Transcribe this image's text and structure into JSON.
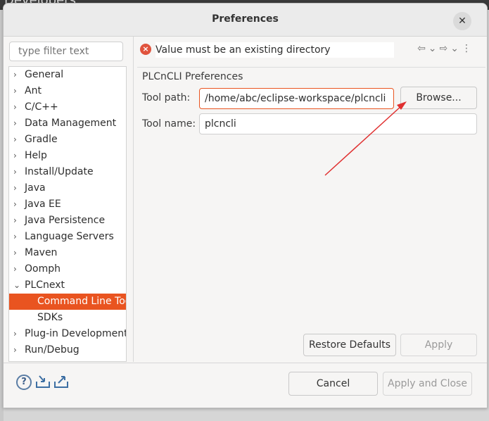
{
  "background": {
    "behind_text": "Developers"
  },
  "dialog": {
    "title": "Preferences",
    "close_glyph": "✕"
  },
  "filter": {
    "placeholder": "type filter text"
  },
  "tree": {
    "items": [
      {
        "label": "General",
        "expanded": false,
        "child": false
      },
      {
        "label": "Ant",
        "expanded": false,
        "child": false
      },
      {
        "label": "C/C++",
        "expanded": false,
        "child": false
      },
      {
        "label": "Data Management",
        "expanded": false,
        "child": false
      },
      {
        "label": "Gradle",
        "expanded": false,
        "child": false
      },
      {
        "label": "Help",
        "expanded": false,
        "child": false
      },
      {
        "label": "Install/Update",
        "expanded": false,
        "child": false
      },
      {
        "label": "Java",
        "expanded": false,
        "child": false
      },
      {
        "label": "Java EE",
        "expanded": false,
        "child": false
      },
      {
        "label": "Java Persistence",
        "expanded": false,
        "child": false
      },
      {
        "label": "Language Servers",
        "expanded": false,
        "child": false
      },
      {
        "label": "Maven",
        "expanded": false,
        "child": false
      },
      {
        "label": "Oomph",
        "expanded": false,
        "child": false
      },
      {
        "label": "PLCnext",
        "expanded": true,
        "child": false
      },
      {
        "label": "Command Line Tool",
        "expanded": false,
        "child": true,
        "selected": true
      },
      {
        "label": "SDKs",
        "expanded": false,
        "child": true
      },
      {
        "label": "Plug-in Development",
        "expanded": false,
        "child": false
      },
      {
        "label": "Run/Debug",
        "expanded": false,
        "child": false
      }
    ],
    "chevron_collapsed": "›",
    "chevron_expanded": "⌄"
  },
  "message": {
    "text": "Value must be an existing directory",
    "icon": "error-icon"
  },
  "page": {
    "section_title": "PLCnCLI Preferences",
    "tool_path_label": "Tool path:",
    "tool_path_value": "/home/abc/eclipse-workspace/plcncli",
    "browse_label": "Browse...",
    "tool_name_label": "Tool name:",
    "tool_name_value": "plcncli"
  },
  "buttons": {
    "restore_defaults": "Restore Defaults",
    "apply": "Apply",
    "cancel": "Cancel",
    "apply_and_close": "Apply and Close"
  },
  "colors": {
    "accent": "#e95420",
    "error": "#e0533d",
    "annotation_arrow": "#e03030"
  }
}
